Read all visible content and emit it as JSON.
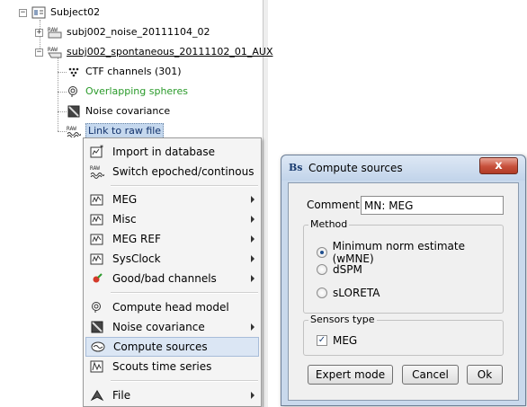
{
  "tree": {
    "subject": "Subject02",
    "nodes": [
      {
        "label": "subj002_noise_20111104_02",
        "badge": "RAW"
      },
      {
        "label": "subj002_spontaneous_20111102_01_AUX",
        "badge": "RAW"
      }
    ],
    "children": [
      {
        "label": "CTF channels (301)",
        "icon": "channels-icon"
      },
      {
        "label": "Overlapping spheres",
        "icon": "headmodel-icon"
      },
      {
        "label": "Noise covariance",
        "icon": "noisecov-icon"
      },
      {
        "label": "Link to raw file",
        "icon": "rawlink-icon",
        "badge": "RAW"
      }
    ]
  },
  "menu": {
    "items": [
      {
        "label": "Import in database",
        "icon": "import-icon",
        "submenu": false
      },
      {
        "label": "Switch epoched/continous",
        "icon": "raw-switch-icon",
        "badge": "RAW",
        "submenu": false
      },
      {
        "label": "MEG",
        "icon": "display-icon",
        "submenu": true
      },
      {
        "label": "Misc",
        "icon": "display-icon",
        "submenu": true
      },
      {
        "label": "MEG REF",
        "icon": "display-icon",
        "submenu": true
      },
      {
        "label": "SysClock",
        "icon": "display-icon",
        "submenu": true
      },
      {
        "label": "Good/bad channels",
        "icon": "goodbad-icon",
        "submenu": true
      },
      {
        "label": "Compute head model",
        "icon": "headmodel-icon",
        "submenu": false
      },
      {
        "label": "Noise covariance",
        "icon": "noisecov-icon",
        "submenu": true
      },
      {
        "label": "Compute sources",
        "icon": "sources-icon",
        "submenu": false
      },
      {
        "label": "Scouts time series",
        "icon": "scouts-icon",
        "submenu": false
      },
      {
        "label": "File",
        "icon": "file-icon",
        "submenu": true
      }
    ],
    "highlighted": "Compute sources"
  },
  "dialog": {
    "title": "Compute sources",
    "app_icon_text": "Bs",
    "close_label": "x",
    "comment_label": "Comment:",
    "comment_value": "MN: MEG",
    "method_title": "Method",
    "methods": [
      "Minimum norm estimate (wMNE)",
      "dSPM",
      "sLORETA"
    ],
    "selected_method": "Minimum norm estimate (wMNE)",
    "sensors_title": "Sensors type",
    "sensor_label": "MEG",
    "sensor_checked": true,
    "buttons": {
      "expert": "Expert mode",
      "cancel": "Cancel",
      "ok": "Ok"
    }
  },
  "colors": {
    "selection": "#c5d8ee",
    "green_text": "#2a9a2a",
    "dialog_frame": "#c9d9ec",
    "close_button": "#c7503b"
  }
}
